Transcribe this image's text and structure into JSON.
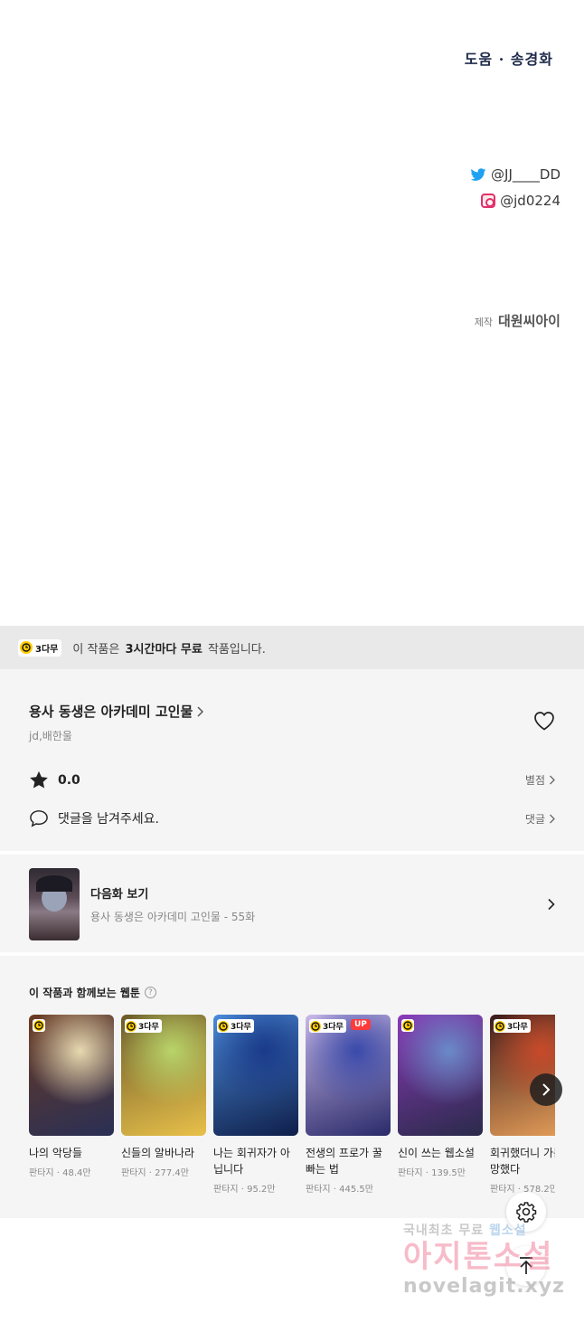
{
  "credits": {
    "assist": "도움 · 송경화",
    "twitter": "@JJ____DD",
    "instagram": "@jd0224",
    "maker_label": "제작",
    "maker_name": "대원씨아이"
  },
  "free_bar": {
    "badge": "3다무",
    "text_before": "이 작품은",
    "text_bold": "3시간마다 무료",
    "text_after": "작품입니다."
  },
  "work": {
    "title": "용사 동생은 아카데미 고인물",
    "author": "jd,배한울",
    "rating": "0.0",
    "rating_link": "별점",
    "comment_prompt": "댓글을 남겨주세요.",
    "comment_link": "댓글"
  },
  "next_episode": {
    "label": "다음화 보기",
    "subtitle": "용사 동생은 아카데미 고인물 - 55화"
  },
  "recommend": {
    "heading": "이 작품과 함께보는 웹툰",
    "help": "?",
    "items": [
      {
        "name": "나의 악당들",
        "genre": "판타지",
        "views": "48.4만",
        "badge": "",
        "up": "",
        "colors": [
          "#e8d9b0",
          "#6a3a22",
          "#2a2f55"
        ]
      },
      {
        "name": "신들의 알바나라",
        "genre": "판타지",
        "views": "277.4만",
        "badge": "3다무",
        "up": "",
        "colors": [
          "#b8d46a",
          "#6a5a2a",
          "#e8c04a"
        ]
      },
      {
        "name": "나는 회귀자가 아닙니다",
        "genre": "판타지",
        "views": "95.2만",
        "badge": "3다무",
        "up": "",
        "colors": [
          "#1a3a8a",
          "#4a8ad8",
          "#0f1f4a"
        ]
      },
      {
        "name": "전생의 프로가 꿀빠는 법",
        "genre": "판타지",
        "views": "445.5만",
        "badge": "3다무",
        "up": "UP",
        "colors": [
          "#3a4aaa",
          "#c8b8e8",
          "#2a2a6a"
        ]
      },
      {
        "name": "신이 쓰는 웹소설",
        "genre": "판타지",
        "views": "139.5만",
        "badge": "",
        "up": "",
        "colors": [
          "#6a8ac8",
          "#8a3ab8",
          "#2a2a4a"
        ]
      },
      {
        "name": "회귀했더니 가문이 망했다",
        "genre": "판타지",
        "views": "578.2만",
        "badge": "3다무",
        "up": "",
        "colors": [
          "#c84a2a",
          "#3a1a1a",
          "#e8a05a"
        ]
      }
    ],
    "separator": " · "
  },
  "watermark": {
    "line1_a": "국내최초 무료",
    "line1_b": "웹소설",
    "line2": "아지톤소설",
    "line3": "novelagit.xyz"
  }
}
